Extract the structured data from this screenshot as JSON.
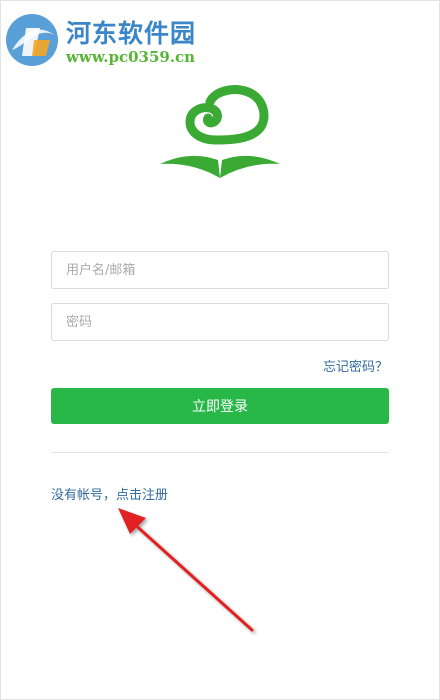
{
  "watermark": {
    "title": "河东软件园",
    "url": "www.pc0359.cn",
    "icon": "hedong-logo-icon"
  },
  "logo": {
    "icon": "cloud-book-logo-icon",
    "color": "#3aaa35"
  },
  "form": {
    "username_placeholder": "用户名/邮箱",
    "password_placeholder": "密码",
    "forgot_label": "忘记密码？",
    "login_label": "立即登录",
    "register_label": "没有帐号，点击注册"
  },
  "annotation": {
    "icon": "red-arrow-icon",
    "color": "#e02020"
  },
  "colors": {
    "accent": "#27b847",
    "link": "#336a9e"
  }
}
